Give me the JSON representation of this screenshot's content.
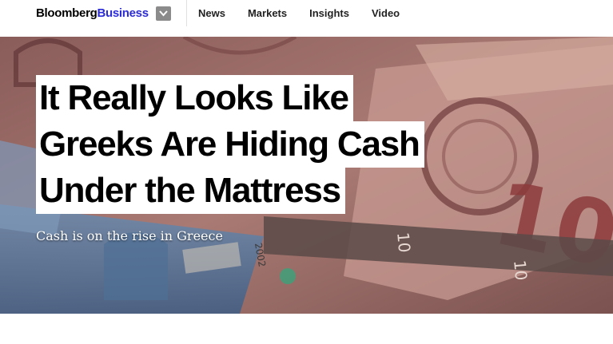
{
  "header": {
    "logo_part1": "Bloomberg",
    "logo_part2": "Business",
    "menu_icon": "chevron-down-icon",
    "nav": [
      "News",
      "Markets",
      "Insights",
      "Video"
    ]
  },
  "article": {
    "headline_lines": [
      "It Really Looks Like",
      "Greeks Are Hiding Cash",
      "Under the Mattress"
    ],
    "dek": "Cash is on the rise in Greece"
  },
  "hero_image": {
    "banknote_texts": [
      "10",
      "10",
      "10",
      "2002"
    ]
  },
  "colors": {
    "logo_business": "#2b2bd8",
    "hero_base": "#6b4a45"
  }
}
